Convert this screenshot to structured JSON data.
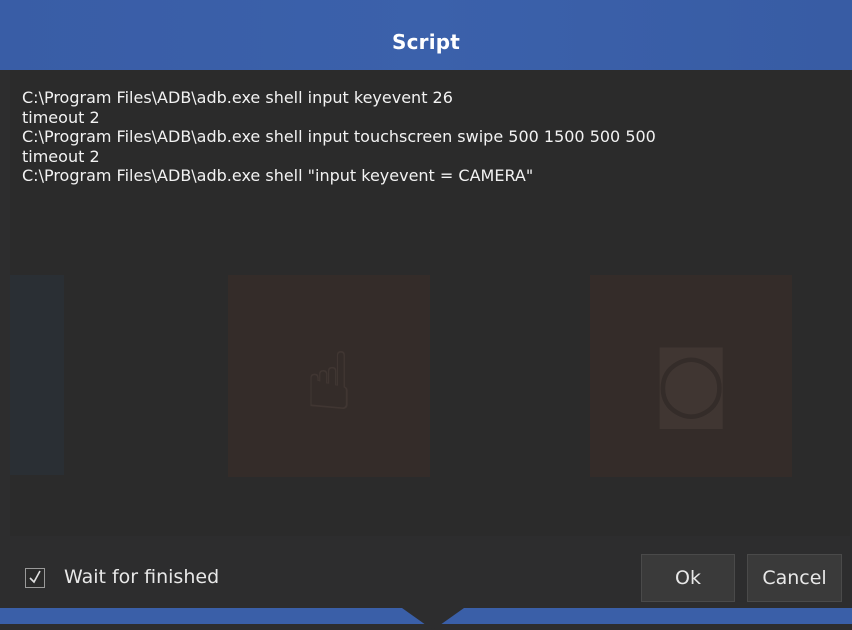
{
  "dialog": {
    "title": "Script"
  },
  "script": {
    "lines": [
      "C:\\Program Files\\ADB\\adb.exe shell input keyevent 26",
      "timeout 2",
      "C:\\Program Files\\ADB\\adb.exe shell input touchscreen swipe 500 1500 500 500",
      "timeout 2",
      "C:\\Program Files\\ADB\\adb.exe shell \"input keyevent = CAMERA\""
    ]
  },
  "options": {
    "wait_label": "Wait for finished",
    "wait_checked": true
  },
  "buttons": {
    "ok_label": "Ok",
    "cancel_label": "Cancel"
  },
  "icons": {
    "checkbox": "check-icon"
  },
  "colors": {
    "title_bar": "#3a5fa8",
    "background": "#2d2d2e",
    "editor": "#2b2b2b",
    "text": "#f2f2f2"
  }
}
